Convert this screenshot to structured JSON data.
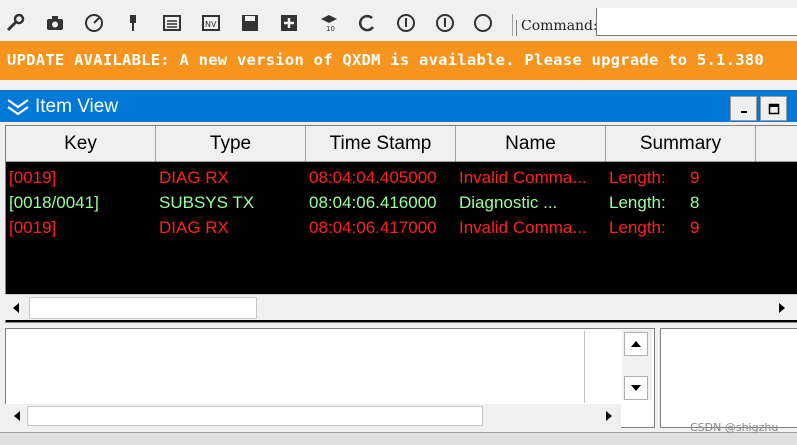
{
  "toolbar": {
    "icons": [
      "wrench-icon",
      "camera-icon",
      "gauge-icon",
      "pin-icon",
      "list-icon",
      "nv-icon",
      "save-icon",
      "add-icon",
      "log-mask-icon",
      "refresh-icon",
      "info-icon",
      "info-icon-2",
      "circle-icon"
    ],
    "command_label": "Command:",
    "command_value": ""
  },
  "banner": {
    "text": "UPDATE AVAILABLE: A new version of QXDM is available. Please upgrade to 5.1.380",
    "color": "#f7941d"
  },
  "item_view": {
    "title": "Item View",
    "minimize_label": "–",
    "maximize_label": "□",
    "columns": [
      "Key",
      "Type",
      "Time Stamp",
      "Name",
      "Summary",
      ""
    ],
    "rows": [
      {
        "key": "[0019]",
        "type": "DIAG RX",
        "time": "08:04:04.405000",
        "name": "Invalid Comma...",
        "summary_label": "Length:",
        "summary_value": "9",
        "color": "#ff2020"
      },
      {
        "key": "[0018/0041]",
        "type": "SUBSYS TX",
        "time": "08:04:06.416000",
        "name": "Diagnostic ...",
        "summary_label": "Length:",
        "summary_value": "8",
        "color": "#9cff9c"
      },
      {
        "key": "[0019]",
        "type": "DIAG RX",
        "time": "08:04:06.417000",
        "name": "Invalid Comma...",
        "summary_label": "Length:",
        "summary_value": "9",
        "color": "#ff2020"
      }
    ]
  },
  "watermark": "CSDN @shigzhu"
}
